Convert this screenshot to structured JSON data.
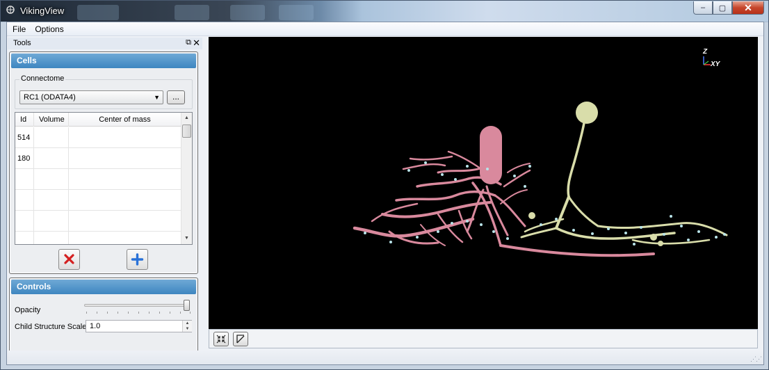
{
  "window": {
    "title": "VikingView",
    "controls": {
      "minimize": "‒",
      "maximize": "▢",
      "close": "✕"
    }
  },
  "menu": {
    "items": [
      "File",
      "Options"
    ]
  },
  "tools_dock": {
    "title": "Tools",
    "float_icon": "⧉",
    "close_icon": "✕",
    "cells_panel": {
      "header": "Cells",
      "connectome_label": "Connectome",
      "connectome_value": "RC1 (ODATA4)",
      "browse_label": "...",
      "table": {
        "columns": [
          "Id",
          "Volume",
          "Center of mass"
        ],
        "rows": [
          {
            "id": "514",
            "volume": "",
            "center_of_mass": ""
          },
          {
            "id": "180",
            "volume": "",
            "center_of_mass": ""
          },
          {
            "id": "",
            "volume": "",
            "center_of_mass": ""
          },
          {
            "id": "",
            "volume": "",
            "center_of_mass": ""
          },
          {
            "id": "",
            "volume": "",
            "center_of_mass": ""
          }
        ]
      },
      "remove_icon": "red-x-icon",
      "add_icon": "blue-plus-icon"
    },
    "controls_panel": {
      "header": "Controls",
      "opacity_label": "Opacity",
      "opacity_value": 1.0,
      "child_scale_label": "Child Structure Scale",
      "child_scale_value": "1.0"
    }
  },
  "view": {
    "axis_z_label": "Z",
    "axis_xy_label": "XY",
    "background": "#000000",
    "cell_colors": {
      "pink": "#d9899d",
      "green": "#d9ddaa"
    }
  },
  "view_toolbar": {
    "reset_icon": "fit-view-icon",
    "axes_icon": "toggle-axes-icon"
  }
}
